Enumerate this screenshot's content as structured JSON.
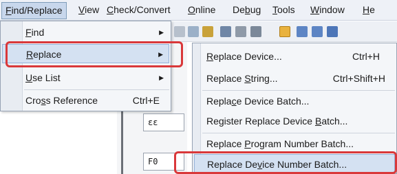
{
  "menubar": {
    "items": [
      {
        "pre": "",
        "u": "F",
        "post": "ind/Replace"
      },
      {
        "pre": "",
        "u": "V",
        "post": "iew"
      },
      {
        "pre": "",
        "u": "C",
        "post": "heck/Convert"
      },
      {
        "pre": "",
        "u": "O",
        "post": "nline"
      },
      {
        "pre": "De",
        "u": "b",
        "post": "ug"
      },
      {
        "pre": "",
        "u": "T",
        "post": "ools"
      },
      {
        "pre": "",
        "u": "W",
        "post": "indow"
      },
      {
        "pre": "",
        "u": "H",
        "post": "e"
      }
    ]
  },
  "find_replace_menu": {
    "items": [
      {
        "pre": "",
        "u": "F",
        "post": "ind",
        "shortcut": "",
        "has_submenu": true
      },
      {
        "pre": "",
        "u": "R",
        "post": "eplace",
        "shortcut": "",
        "has_submenu": true
      },
      {
        "pre": "",
        "u": "U",
        "post": "se List",
        "shortcut": "",
        "has_submenu": true
      },
      {
        "pre": "Cro",
        "u": "s",
        "post": "s Reference",
        "shortcut": "Ctrl+E",
        "has_submenu": false
      }
    ]
  },
  "replace_submenu": {
    "items": [
      {
        "pre": "",
        "u": "R",
        "post": "eplace Device...",
        "shortcut": "Ctrl+H"
      },
      {
        "pre": "Replace ",
        "u": "S",
        "post": "tring...",
        "shortcut": "Ctrl+Shift+H"
      },
      {
        "pre": "Repla",
        "u": "c",
        "post": "e Device Batch...",
        "shortcut": ""
      },
      {
        "pre": "Register Replace Device ",
        "u": "B",
        "post": "atch...",
        "shortcut": ""
      },
      {
        "pre": "Replace ",
        "u": "P",
        "post": "rogram Number Batch...",
        "shortcut": ""
      },
      {
        "pre": "Replace De",
        "u": "v",
        "post": "ice Number Batch...",
        "shortcut": ""
      }
    ]
  },
  "background": {
    "cell_1": "εε",
    "cell_2": "F0"
  },
  "colors": {
    "callout": "#d9383a",
    "hover": "#d4e1f2"
  }
}
